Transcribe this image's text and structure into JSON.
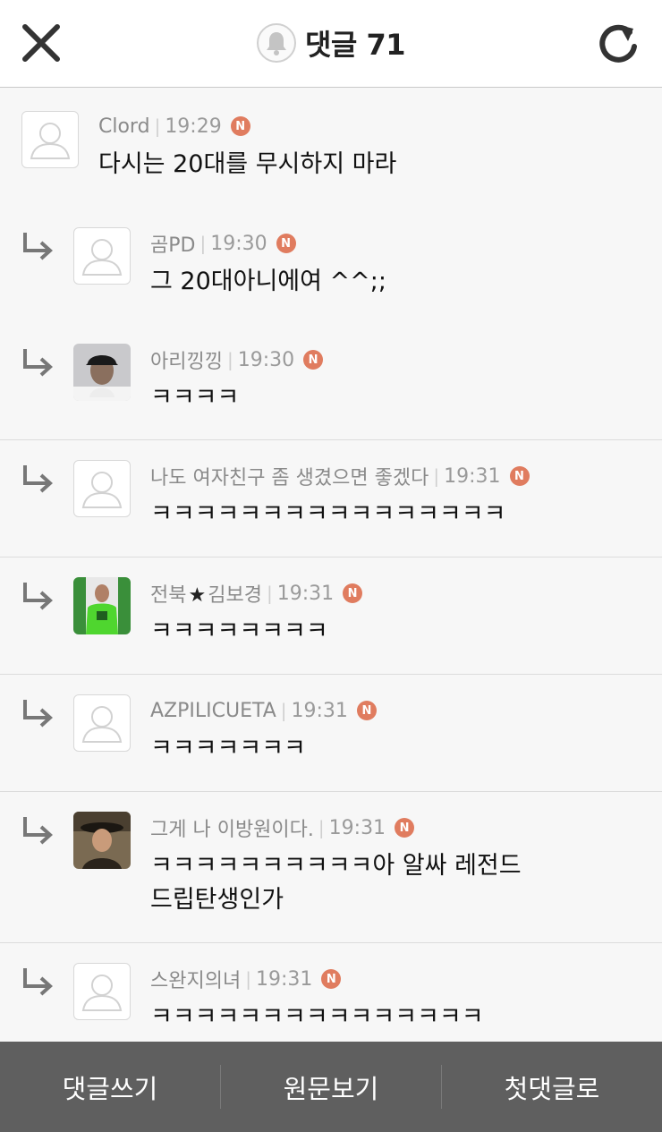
{
  "header": {
    "title": "댓글 71"
  },
  "comments": [
    {
      "nick": "Clord",
      "time": "19:29",
      "badge": "N",
      "text": "다시는 20대를 무시하지 마라",
      "reply": false,
      "avatar": "default-avatar"
    },
    {
      "nick": "곰PD",
      "time": "19:30",
      "badge": "N",
      "text": "그 20대아니에여 ^^;;",
      "reply": true,
      "avatar": "default-avatar"
    },
    {
      "nick": "아리낑낑",
      "time": "19:30",
      "badge": "N",
      "text": "ㅋㅋㅋㅋ",
      "reply": true,
      "avatar": "photo-cap-man"
    },
    {
      "nick": "나도 여자친구 좀 생겼으면 좋겠다",
      "time": "19:31",
      "badge": "N",
      "text": "ㅋㅋㅋㅋㅋㅋㅋㅋㅋㅋㅋㅋㅋㅋㅋㅋ",
      "reply": true,
      "avatar": "default-avatar"
    },
    {
      "nick_before": "전북",
      "nick_star": "★",
      "nick_after": "김보경",
      "time": "19:31",
      "badge": "N",
      "text": "ㅋㅋㅋㅋㅋㅋㅋㅋ",
      "reply": true,
      "avatar": "photo-green-jersey"
    },
    {
      "nick": "AZPILICUETA",
      "time": "19:31",
      "badge": "N",
      "text": "ㅋㅋㅋㅋㅋㅋㅋ",
      "reply": true,
      "avatar": "default-avatar"
    },
    {
      "nick": "그게 나 이방원이다.",
      "time": "19:31",
      "badge": "N",
      "text_line1": "ㅋㅋㅋㅋㅋㅋㅋㅋㅋㅋ아 알싸 레전드",
      "text_line2": "드립탄생인가",
      "reply": true,
      "avatar": "photo-period-drama"
    },
    {
      "nick": "스완지의녀",
      "time": "19:31",
      "badge": "N",
      "text": "ㅋㅋㅋㅋㅋㅋㅋㅋㅋㅋㅋㅋㅋㅋㅋ",
      "reply": true,
      "avatar": "default-avatar"
    }
  ],
  "bottom_bar": {
    "write": "댓글쓰기",
    "original": "원문보기",
    "first": "첫댓글로"
  },
  "colors": {
    "badge": "#e07c5f",
    "bottom_bar": "#5f5f5f",
    "header_bg": "#ffffff",
    "list_bg": "#f7f7f7"
  },
  "icons": [
    "close-icon",
    "bell-icon",
    "refresh-icon",
    "reply-arrow-icon",
    "default-avatar-icon"
  ]
}
